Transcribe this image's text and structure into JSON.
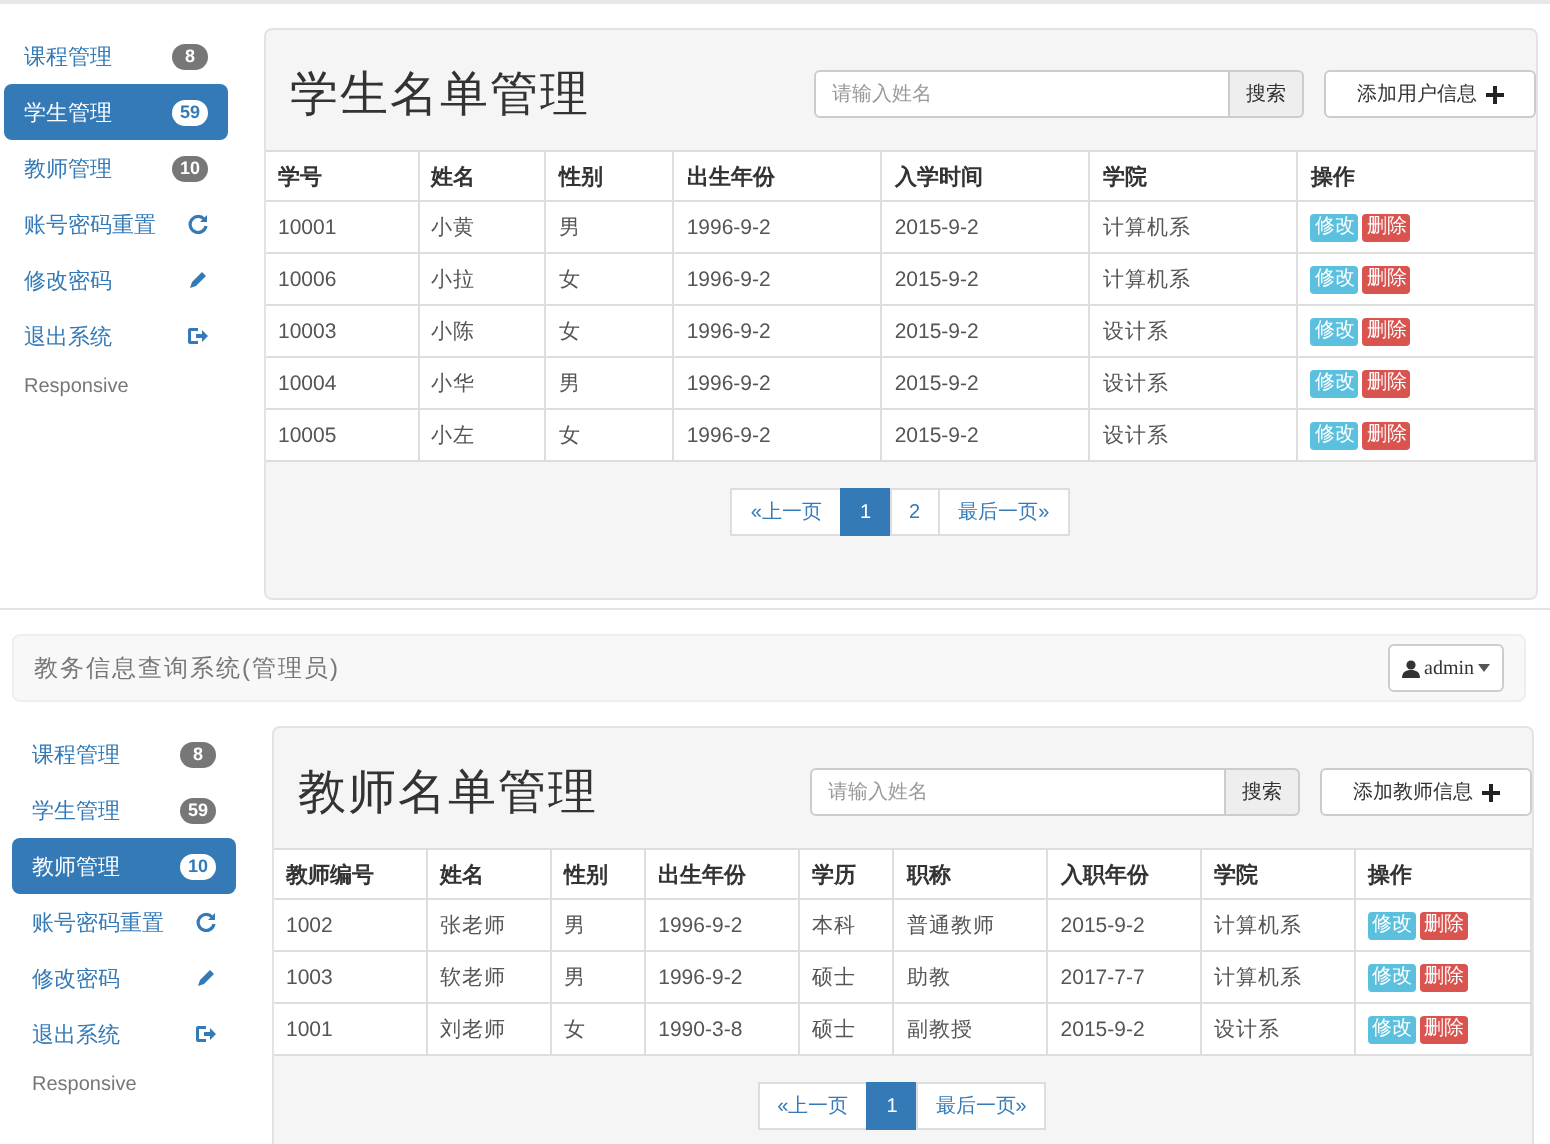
{
  "screens": [
    {
      "sidebar": [
        {
          "label": "课程管理",
          "kind": "badge",
          "badge": "8",
          "selected": false
        },
        {
          "label": "学生管理",
          "kind": "badge",
          "badge": "59",
          "selected": true
        },
        {
          "label": "教师管理",
          "kind": "badge",
          "badge": "10",
          "selected": false
        },
        {
          "label": "账号密码重置",
          "kind": "refresh",
          "selected": false
        },
        {
          "label": "修改密码",
          "kind": "edit",
          "selected": false
        },
        {
          "label": "退出系统",
          "kind": "logout",
          "selected": false
        },
        {
          "label": "Responsive",
          "kind": "text"
        }
      ],
      "panel": {
        "title": "学生名单管理",
        "search": {
          "placeholder": "请输入姓名",
          "button": "搜索"
        },
        "add_button": "添加用户信息",
        "columns": [
          "学号",
          "姓名",
          "性别",
          "出生年份",
          "入学时间",
          "学院",
          "操作"
        ],
        "rows": [
          {
            "cells": [
              "10001",
              "小黄",
              "男",
              "1996-9-2",
              "2015-9-2",
              "计算机系"
            ],
            "actions": [
              "修改",
              "删除"
            ]
          },
          {
            "cells": [
              "10006",
              "小拉",
              "女",
              "1996-9-2",
              "2015-9-2",
              "计算机系"
            ],
            "actions": [
              "修改",
              "删除"
            ]
          },
          {
            "cells": [
              "10003",
              "小陈",
              "女",
              "1996-9-2",
              "2015-9-2",
              "设计系"
            ],
            "actions": [
              "修改",
              "删除"
            ]
          },
          {
            "cells": [
              "10004",
              "小华",
              "男",
              "1996-9-2",
              "2015-9-2",
              "设计系"
            ],
            "actions": [
              "修改",
              "删除"
            ]
          },
          {
            "cells": [
              "10005",
              "小左",
              "女",
              "1996-9-2",
              "2015-9-2",
              "设计系"
            ],
            "actions": [
              "修改",
              "删除"
            ]
          }
        ],
        "pagination": [
          {
            "label": "«上一页",
            "selected": false
          },
          {
            "label": "1",
            "selected": true
          },
          {
            "label": "2",
            "selected": false
          },
          {
            "label": "最后一页»",
            "selected": false
          }
        ]
      }
    },
    {
      "navbar": {
        "brand": "教务信息查询系统(管理员)",
        "user": "admin"
      },
      "sidebar": [
        {
          "label": "课程管理",
          "kind": "badge",
          "badge": "8",
          "selected": false
        },
        {
          "label": "学生管理",
          "kind": "badge",
          "badge": "59",
          "selected": false
        },
        {
          "label": "教师管理",
          "kind": "badge",
          "badge": "10",
          "selected": true
        },
        {
          "label": "账号密码重置",
          "kind": "refresh",
          "selected": false
        },
        {
          "label": "修改密码",
          "kind": "edit",
          "selected": false
        },
        {
          "label": "退出系统",
          "kind": "logout",
          "selected": false
        },
        {
          "label": "Responsive",
          "kind": "text"
        }
      ],
      "panel": {
        "title": "教师名单管理",
        "search": {
          "placeholder": "请输入姓名",
          "button": "搜索"
        },
        "add_button": "添加教师信息",
        "columns": [
          "教师编号",
          "姓名",
          "性别",
          "出生年份",
          "学历",
          "职称",
          "入职年份",
          "学院",
          "操作"
        ],
        "rows": [
          {
            "cells": [
              "1002",
              "张老师",
              "男",
              "1996-9-2",
              "本科",
              "普通教师",
              "2015-9-2",
              "计算机系"
            ],
            "actions": [
              "修改",
              "删除"
            ]
          },
          {
            "cells": [
              "1003",
              "软老师",
              "男",
              "1996-9-2",
              "硕士",
              "助教",
              "2017-7-7",
              "计算机系"
            ],
            "actions": [
              "修改",
              "删除"
            ]
          },
          {
            "cells": [
              "1001",
              "刘老师",
              "女",
              "1990-3-8",
              "硕士",
              "副教授",
              "2015-9-2",
              "设计系"
            ],
            "actions": [
              "修改",
              "删除"
            ]
          }
        ],
        "pagination": [
          {
            "label": "«上一页",
            "selected": false
          },
          {
            "label": "1",
            "selected": true
          },
          {
            "label": "最后一页»",
            "selected": false
          }
        ]
      }
    }
  ]
}
